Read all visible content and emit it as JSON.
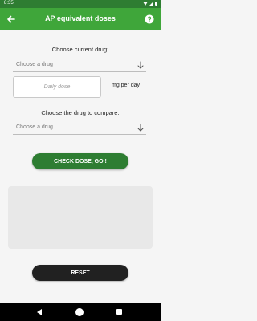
{
  "status_bar": {
    "time": "8:35"
  },
  "app_bar": {
    "title": "AP equivalent doses"
  },
  "form": {
    "current_drug_label": "Choose current drug:",
    "current_drug_select": "Choose a drug",
    "dose_placeholder": "Daily dose",
    "dose_value": "",
    "dose_unit": "mg per day",
    "compare_drug_label": "Choose the drug to compare:",
    "compare_drug_select": "Choose a drug"
  },
  "buttons": {
    "check": "CHECK DOSE, GO !",
    "reset": "RESET"
  },
  "result": {
    "text": ""
  },
  "colors": {
    "appbar": "#3fa63a",
    "statusbar": "#2e7d32",
    "primary_button": "#2e7d32",
    "reset_button": "#212121",
    "result_box": "#e8e8e8"
  }
}
